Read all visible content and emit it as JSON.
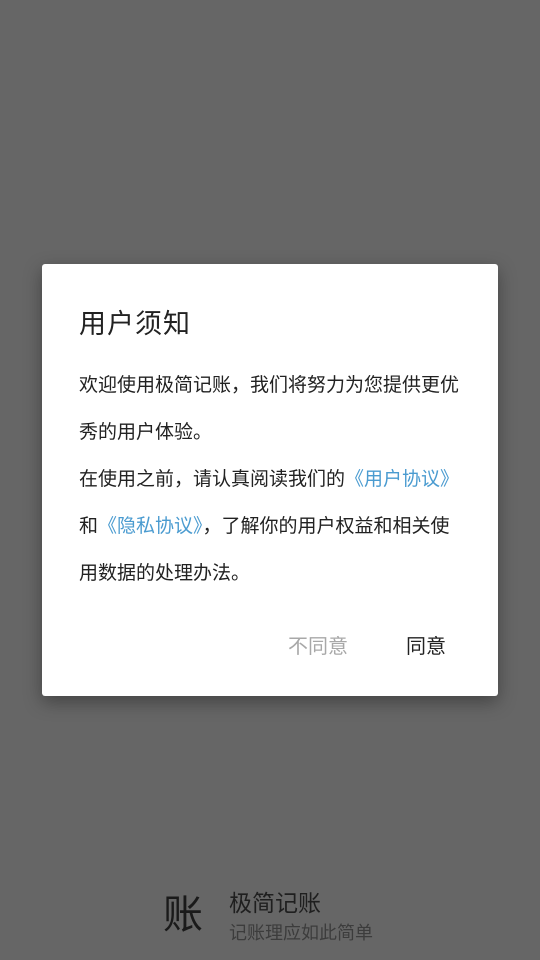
{
  "dialog": {
    "title": "用户须知",
    "para1": "欢迎使用极简记账，我们将努力为您提供更优秀的用户体验。",
    "para2_prefix": "在使用之前，请认真阅读我们的",
    "user_agreement_link": "《用户协议》",
    "para2_and": "和",
    "privacy_policy_link": "《隐私协议》",
    "para2_suffix": "，了解你的用户权益和相关使用数据的处理办法。",
    "disagree_label": "不同意",
    "agree_label": "同意"
  },
  "brand": {
    "logo_glyph": "账",
    "name": "极简记账",
    "slogan": "记账理应如此简单"
  },
  "colors": {
    "overlay": "#666666",
    "link": "#4a9bd0",
    "disabled_text": "#a8a8a8"
  }
}
